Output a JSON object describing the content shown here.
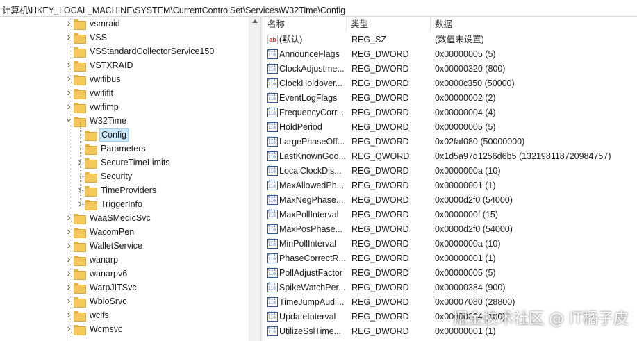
{
  "address_bar": {
    "path": "计算机\\HKEY_LOCAL_MACHINE\\SYSTEM\\CurrentControlSet\\Services\\W32Time\\Config"
  },
  "tree": {
    "items": [
      {
        "label": "vsmraid",
        "level": 0,
        "expander": ">"
      },
      {
        "label": "VSS",
        "level": 0,
        "expander": ">"
      },
      {
        "label": "VSStandardCollectorService150",
        "level": 0,
        "expander": ""
      },
      {
        "label": "VSTXRAID",
        "level": 0,
        "expander": ">"
      },
      {
        "label": "vwifibus",
        "level": 0,
        "expander": ">"
      },
      {
        "label": "vwififlt",
        "level": 0,
        "expander": ">"
      },
      {
        "label": "vwifimp",
        "level": 0,
        "expander": ">"
      },
      {
        "label": "W32Time",
        "level": 0,
        "expander": "v"
      },
      {
        "label": "Config",
        "level": 1,
        "expander": "",
        "selected": true
      },
      {
        "label": "Parameters",
        "level": 1,
        "expander": ""
      },
      {
        "label": "SecureTimeLimits",
        "level": 1,
        "expander": ">"
      },
      {
        "label": "Security",
        "level": 1,
        "expander": ""
      },
      {
        "label": "TimeProviders",
        "level": 1,
        "expander": ">"
      },
      {
        "label": "TriggerInfo",
        "level": 1,
        "expander": ">"
      },
      {
        "label": "WaaSMedicSvc",
        "level": 0,
        "expander": ">"
      },
      {
        "label": "WacomPen",
        "level": 0,
        "expander": ">"
      },
      {
        "label": "WalletService",
        "level": 0,
        "expander": ">"
      },
      {
        "label": "wanarp",
        "level": 0,
        "expander": ">"
      },
      {
        "label": "wanarpv6",
        "level": 0,
        "expander": ">"
      },
      {
        "label": "WarpJITSvc",
        "level": 0,
        "expander": ">"
      },
      {
        "label": "WbioSrvc",
        "level": 0,
        "expander": ">"
      },
      {
        "label": "wcifs",
        "level": 0,
        "expander": ">"
      },
      {
        "label": "Wcmsvc",
        "level": 0,
        "expander": ">"
      }
    ]
  },
  "list": {
    "columns": {
      "name": "名称",
      "type": "类型",
      "data": "数据"
    },
    "rows": [
      {
        "name": "(默认)",
        "type": "REG_SZ",
        "data": "(数值未设置)",
        "icon": "string-value-icon"
      },
      {
        "name": "AnnounceFlags",
        "type": "REG_DWORD",
        "data": "0x00000005 (5)",
        "icon": "binary-value-icon"
      },
      {
        "name": "ClockAdjustme...",
        "type": "REG_DWORD",
        "data": "0x00000320 (800)",
        "icon": "binary-value-icon"
      },
      {
        "name": "ClockHoldover...",
        "type": "REG_DWORD",
        "data": "0x0000c350 (50000)",
        "icon": "binary-value-icon"
      },
      {
        "name": "EventLogFlags",
        "type": "REG_DWORD",
        "data": "0x00000002 (2)",
        "icon": "binary-value-icon"
      },
      {
        "name": "FrequencyCorr...",
        "type": "REG_DWORD",
        "data": "0x00000004 (4)",
        "icon": "binary-value-icon"
      },
      {
        "name": "HoldPeriod",
        "type": "REG_DWORD",
        "data": "0x00000005 (5)",
        "icon": "binary-value-icon"
      },
      {
        "name": "LargePhaseOff...",
        "type": "REG_DWORD",
        "data": "0x02faf080 (50000000)",
        "icon": "binary-value-icon"
      },
      {
        "name": "LastKnownGoo...",
        "type": "REG_QWORD",
        "data": "0x1d5a97d1256d6b5 (132198118720984757)",
        "icon": "binary-value-icon"
      },
      {
        "name": "LocalClockDis...",
        "type": "REG_DWORD",
        "data": "0x0000000a (10)",
        "icon": "binary-value-icon"
      },
      {
        "name": "MaxAllowedPh...",
        "type": "REG_DWORD",
        "data": "0x00000001 (1)",
        "icon": "binary-value-icon"
      },
      {
        "name": "MaxNegPhase...",
        "type": "REG_DWORD",
        "data": "0x0000d2f0 (54000)",
        "icon": "binary-value-icon"
      },
      {
        "name": "MaxPollInterval",
        "type": "REG_DWORD",
        "data": "0x0000000f (15)",
        "icon": "binary-value-icon"
      },
      {
        "name": "MaxPosPhase...",
        "type": "REG_DWORD",
        "data": "0x0000d2f0 (54000)",
        "icon": "binary-value-icon"
      },
      {
        "name": "MinPollInterval",
        "type": "REG_DWORD",
        "data": "0x0000000a (10)",
        "icon": "binary-value-icon"
      },
      {
        "name": "PhaseCorrectR...",
        "type": "REG_DWORD",
        "data": "0x00000001 (1)",
        "icon": "binary-value-icon"
      },
      {
        "name": "PollAdjustFactor",
        "type": "REG_DWORD",
        "data": "0x00000005 (5)",
        "icon": "binary-value-icon"
      },
      {
        "name": "SpikeWatchPer...",
        "type": "REG_DWORD",
        "data": "0x00000384 (900)",
        "icon": "binary-value-icon"
      },
      {
        "name": "TimeJumpAudi...",
        "type": "REG_DWORD",
        "data": "0x00007080 (28800)",
        "icon": "binary-value-icon"
      },
      {
        "name": "UpdateInterval",
        "type": "REG_DWORD",
        "data": "0x00000064 (100)",
        "icon": "binary-value-icon"
      },
      {
        "name": "UtilizeSslTime...",
        "type": "REG_DWORD",
        "data": "0x00000001 (1)",
        "icon": "binary-value-icon"
      }
    ]
  },
  "watermark": {
    "text": "掘金技术社区 @ IT橘子皮"
  }
}
